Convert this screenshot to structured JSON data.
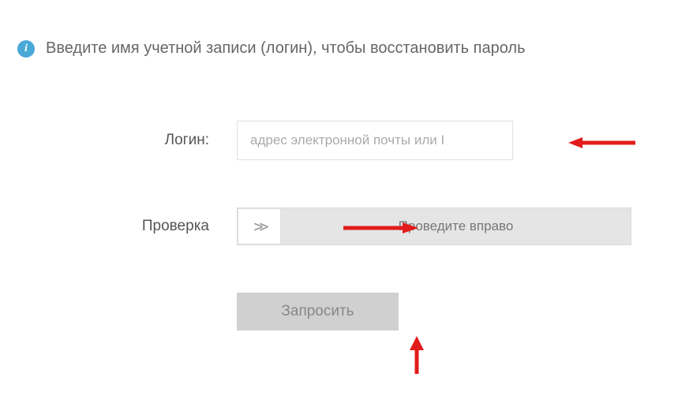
{
  "instruction": "Введите имя учетной записи (логин), чтобы восстановить пароль",
  "form": {
    "login_label": "Логин:",
    "login_placeholder": "адрес электронной почты или I",
    "verify_label": "Проверка",
    "slider_text": "Проведите вправо",
    "submit_label": "Запросить"
  }
}
